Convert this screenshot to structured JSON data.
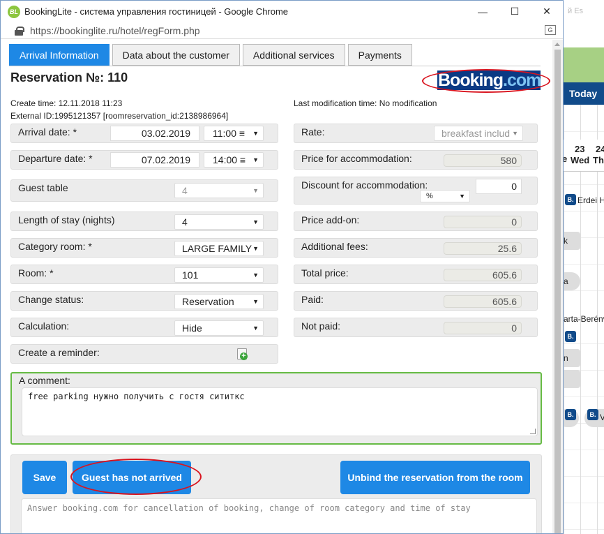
{
  "window": {
    "app_icon": "BL",
    "title": "BookingLite - система управления гостиницей - Google Chrome",
    "url": "https://bookinglite.ru/hotel/regForm.php",
    "controls": [
      "—",
      "☐",
      "✕"
    ]
  },
  "background_app": {
    "top_label": "й Es",
    "today": "Today",
    "day_23": "23",
    "day_23_name": "Wed",
    "day_24": "24",
    "day_24_name": "Th",
    "left_e": "e",
    "booking_badge": "B.",
    "names": [
      "Erdei H",
      "k",
      "a",
      "arta-Berénv",
      "n",
      "V"
    ]
  },
  "tabs": [
    {
      "label": "Arrival Information",
      "active": true
    },
    {
      "label": "Data about the customer",
      "active": false
    },
    {
      "label": "Additional services",
      "active": false
    },
    {
      "label": "Payments",
      "active": false
    }
  ],
  "reservation": {
    "title": "Reservation №: 110",
    "logo_main": "Booking",
    "logo_dot": ".com",
    "create_time": "Create time: 12.11.2018 11:23",
    "external_id": "External ID:1995121357 [roomreservation_id:2138986964]",
    "last_mod": "Last modification time: No modification"
  },
  "left": {
    "arrival_label": "Arrival date: *",
    "arrival_date": "03.02.2019",
    "arrival_time": "11:00 ≡",
    "departure_label": "Departure date: *",
    "departure_date": "07.02.2019",
    "departure_time": "14:00 ≡",
    "guest_table_label": "Guest table",
    "guest_table_value": "4",
    "length_label": "Length of stay (nights)",
    "length_value": "4",
    "category_label": "Category room: *",
    "category_value": "LARGE FAMILY",
    "room_label": "Room: *",
    "room_value": "101",
    "status_label": "Change status:",
    "status_value": "Reservation",
    "calc_label": "Calculation:",
    "calc_value": "Hide",
    "reminder_label": "Create a reminder:"
  },
  "right": {
    "rate_label": "Rate:",
    "rate_value": "breakfast includ",
    "price_label": "Price for accommodation:",
    "price_value": "580",
    "discount_label": "Discount for accommodation:",
    "discount_value": "0",
    "discount_unit": "%",
    "addon_label": "Price add-on:",
    "addon_value": "0",
    "fees_label": "Additional fees:",
    "fees_value": "25.6",
    "total_label": "Total price:",
    "total_value": "605.6",
    "paid_label": "Paid:",
    "paid_value": "605.6",
    "notpaid_label": "Not paid:",
    "notpaid_value": "0"
  },
  "comment": {
    "label": "A comment:",
    "text": "free parking   нужно получить с гостя сититкс"
  },
  "actions": {
    "save": "Save",
    "not_arrived": "Guest has not arrived",
    "unbind": "Unbind the reservation from the room",
    "answer_placeholder": "Answer booking.com for cancellation of booking, change of room category and time of stay"
  },
  "colors": {
    "accent": "#1e88e5",
    "booking_blue": "#0b3a84",
    "highlight_red": "#d9141f",
    "comment_border": "#66bb44"
  }
}
